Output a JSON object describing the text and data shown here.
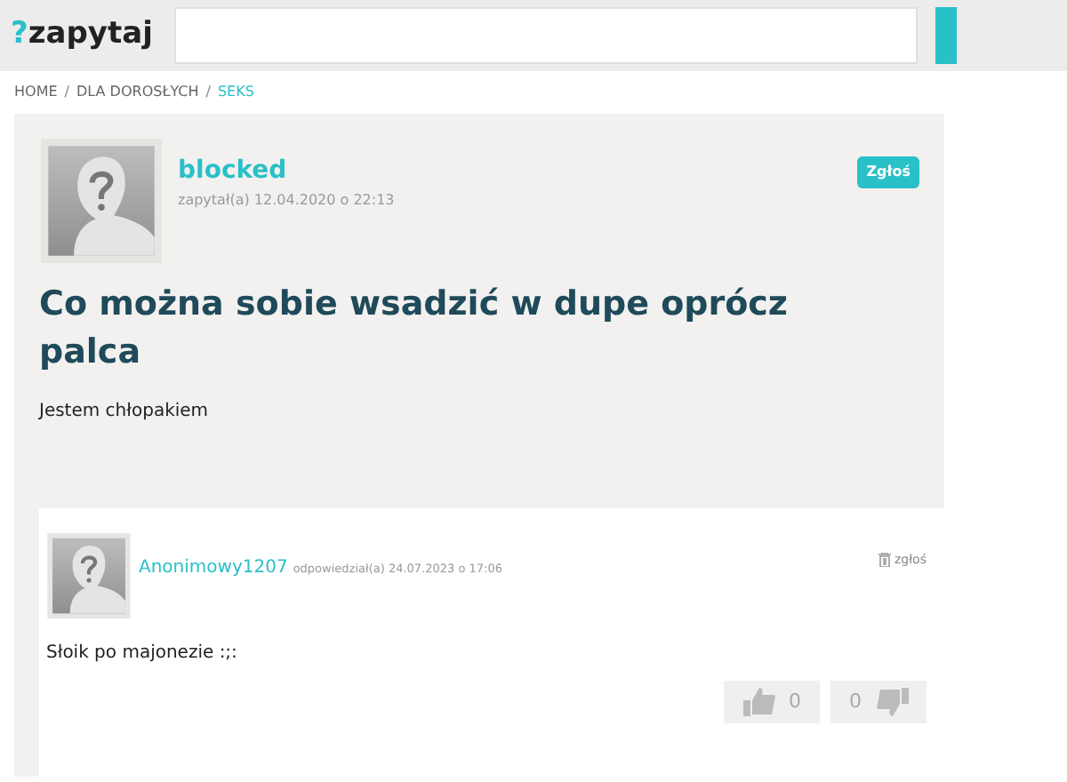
{
  "header": {
    "logo_mark": "?",
    "logo_text": "zapytaj"
  },
  "breadcrumb": [
    {
      "label": "HOME",
      "selected": false
    },
    {
      "label": "DLA DOROSŁYCH",
      "selected": false
    },
    {
      "label": "SEKS",
      "selected": true
    }
  ],
  "breadcrumb_separator": "/",
  "question": {
    "author": "blocked",
    "meta": "zapytał(a) 12.04.2020 o 22:13",
    "report": "Zgłoś",
    "title": "Co można sobie wsadzić w dupe oprócz palca",
    "body": "Jestem chłopakiem"
  },
  "answers": [
    {
      "author": "Anonimowy1207",
      "meta": "odpowiedział(a) 24.07.2023 o 17:06",
      "report": "zgłoś",
      "body": "Słoik po majonezie :;:",
      "likes": "0",
      "dislikes": "0"
    }
  ]
}
